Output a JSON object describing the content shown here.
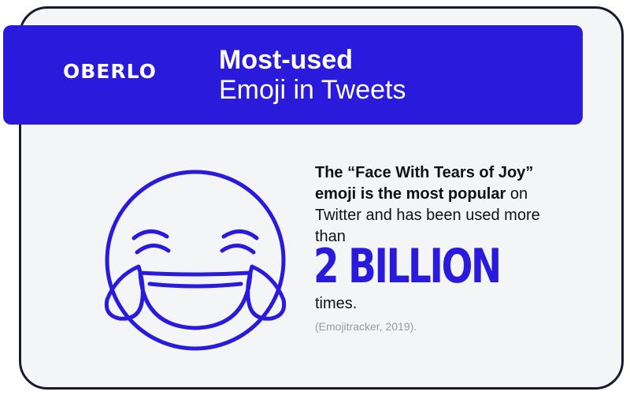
{
  "brand": {
    "logo_text": "OBERLO",
    "accent_color": "#2a1bdc"
  },
  "header": {
    "title_line1": "Most-used",
    "title_line2": "Emoji in Tweets"
  },
  "illustration": {
    "icon": "face-with-tears-of-joy-icon"
  },
  "fact": {
    "bold_part": "The “Face With Tears of Joy” emoji is the most popular",
    "normal_part": " on Twitter and has been used more than",
    "big_number": "2 BILLION",
    "suffix": "times.",
    "source": "(Emojitracker, 2019)."
  }
}
